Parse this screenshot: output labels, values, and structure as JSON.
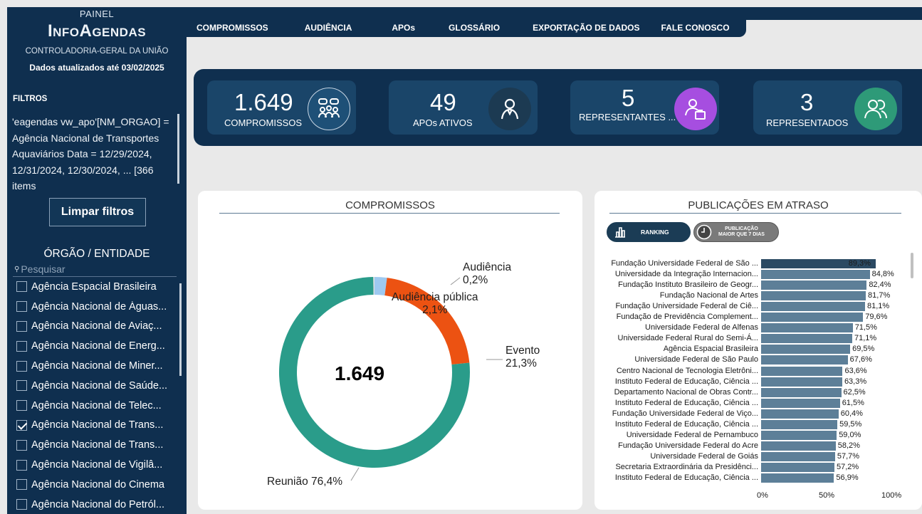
{
  "brand": {
    "top": "PAINEL",
    "name": "InfoAgendas",
    "org": "CONTROLADORIA-GERAL DA UNIÃO",
    "updated": "Dados atualizados até 03/02/2025"
  },
  "filters": {
    "label": "FILTROS",
    "text": "'eagendas vw_apo'[NM_ORGAO] = Agência Nacional de Transportes Aquaviários Data = 12/29/2024, 12/31/2024, 12/30/2024, ... [366 items",
    "clear_label": "Limpar filtros"
  },
  "org_filter": {
    "heading": "ÓRGÃO / ENTIDADE",
    "search_placeholder": "Pesquisar",
    "items": [
      {
        "label": "Agência Espacial Brasileira",
        "checked": false
      },
      {
        "label": "Agência Nacional de Águas...",
        "checked": false
      },
      {
        "label": "Agência Nacional de Aviaç...",
        "checked": false
      },
      {
        "label": "Agência Nacional de Energ...",
        "checked": false
      },
      {
        "label": "Agência Nacional de Miner...",
        "checked": false
      },
      {
        "label": "Agência Nacional de Saúde...",
        "checked": false
      },
      {
        "label": "Agência Nacional de Telec...",
        "checked": false
      },
      {
        "label": "Agência Nacional de Trans...",
        "checked": true
      },
      {
        "label": "Agência Nacional de Trans...",
        "checked": false
      },
      {
        "label": "Agência Nacional de Vigilâ...",
        "checked": false
      },
      {
        "label": "Agência Nacional do Cinema",
        "checked": false
      },
      {
        "label": "Agência Nacional do Petról...",
        "checked": false
      }
    ]
  },
  "nav": {
    "items": [
      "COMPROMISSOS",
      "AUDIÊNCIA",
      "APOs",
      "GLOSSÁRIO",
      "EXPORTAÇÃO DE DADOS",
      "FALE CONOSCO"
    ]
  },
  "kpis": [
    {
      "value": "1.649",
      "label": "COMPROMISSOS",
      "icon": "people-chat-icon",
      "color": "#1a4569"
    },
    {
      "value": "49",
      "label": "APOs ATIVOS",
      "icon": "person-icon",
      "color": "#1c3a52"
    },
    {
      "value": "5",
      "label": "REPRESENTANTES ...",
      "icon": "representative-icon",
      "color": "#a64ee0"
    },
    {
      "value": "3",
      "label": "REPRESENTADOS",
      "icon": "group-icon",
      "color": "#2e9a78"
    }
  ],
  "donut_card": {
    "title": "COMPROMISSOS",
    "center_value": "1.649"
  },
  "ranking_card": {
    "title": "PUBLICAÇÕES EM ATRASO",
    "toggle_ranking": "RANKING",
    "toggle_pub_line1": "PUBLICAÇÃO",
    "toggle_pub_line2": "MAIOR QUE 7 DIAS"
  },
  "chart_data": [
    {
      "type": "pie",
      "title": "COMPROMISSOS",
      "categories": [
        "Reunião",
        "Evento",
        "Audiência pública",
        "Audiência"
      ],
      "values": [
        76.4,
        21.3,
        2.1,
        0.2
      ],
      "labels": [
        "Reunião 76,4%",
        "Evento 21,3%",
        "Audiência pública 2,1%",
        "Audiência 0,2%"
      ],
      "colors": [
        "#2a9c8a",
        "#ec5212",
        "#9ec9f0",
        "#e0e0e0"
      ]
    },
    {
      "type": "bar",
      "orientation": "horizontal",
      "title": "PUBLICAÇÕES EM ATRASO",
      "categories": [
        "Fundação Universidade Federal de São ...",
        "Universidade da Integração Internacion...",
        "Fundação Instituto Brasileiro de Geogr...",
        "Fundação Nacional de Artes",
        "Fundação Universidade Federal de Ciê...",
        "Fundação de Previdência Complement...",
        "Universidade Federal de Alfenas",
        "Universidade Federal Rural do Semi-Á...",
        "Agência Espacial Brasileira",
        "Universidade Federal de São Paulo",
        "Centro Nacional de Tecnologia Eletrôni...",
        "Instituto Federal de Educação, Ciência ...",
        "Departamento Nacional de Obras Contr...",
        "Instituto Federal de Educação, Ciência ...",
        "Fundação Universidade Federal de Viço...",
        "Instituto Federal de Educação, Ciência ...",
        "Universidade Federal de Pernambuco",
        "Fundação Universidade Federal do Acre",
        "Universidade Federal de Goiás",
        "Secretaria Extraordinária da Presidênci...",
        "Instituto Federal de Educação, Ciência ..."
      ],
      "values": [
        89.3,
        84.8,
        82.4,
        81.7,
        81.1,
        79.6,
        71.5,
        71.1,
        69.5,
        67.6,
        63.6,
        63.3,
        62.5,
        61.5,
        60.4,
        59.5,
        59.0,
        58.2,
        57.7,
        57.2,
        56.9
      ],
      "value_labels": [
        "89,3%",
        "84,8%",
        "82,4%",
        "81,7%",
        "81,1%",
        "79,6%",
        "71,5%",
        "71,1%",
        "69,5%",
        "67,6%",
        "63,6%",
        "63,3%",
        "62,5%",
        "61,5%",
        "60,4%",
        "59,5%",
        "59,0%",
        "58,2%",
        "57,7%",
        "57,2%",
        "56,9%"
      ],
      "xlim": [
        0,
        100
      ],
      "xticks": [
        "0%",
        "50%",
        "100%"
      ],
      "colors": {
        "top": "#2b4a63",
        "rest": "#5d7f98"
      }
    }
  ]
}
